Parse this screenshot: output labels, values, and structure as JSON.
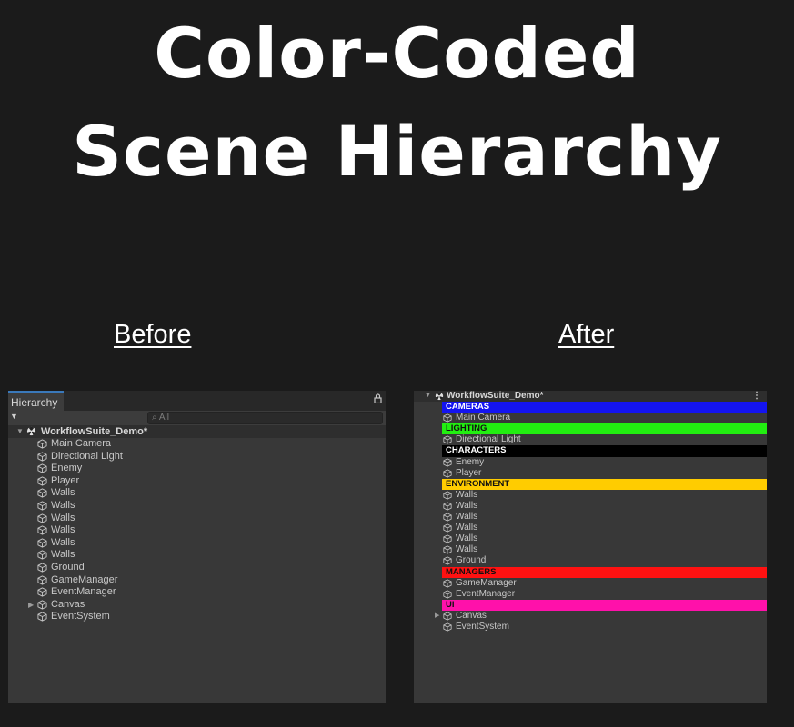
{
  "title": {
    "line1": "Color-Coded",
    "line2": "Scene Hierarchy"
  },
  "captions": {
    "before": "Before",
    "after": "After"
  },
  "before": {
    "tab_label": "Hierarchy",
    "lock_icon": "lock-icon",
    "search_placeholder": "All",
    "scene_name": "WorkflowSuite_Demo*",
    "items": [
      "Main Camera",
      "Directional Light",
      "Enemy",
      "Player",
      "Walls",
      "Walls",
      "Walls",
      "Walls",
      "Walls",
      "Walls",
      "Ground",
      "GameManager",
      "EventManager",
      "Canvas",
      "EventSystem"
    ]
  },
  "after": {
    "scene_name": "WorkflowSuite_Demo*",
    "rows": [
      {
        "kind": "header",
        "label": "CAMERAS",
        "bg": "#1414f0",
        "fg": "#ffffff"
      },
      {
        "kind": "item",
        "label": "Main Camera"
      },
      {
        "kind": "header",
        "label": "LIGHTING",
        "bg": "#22ee11",
        "fg": "#111111"
      },
      {
        "kind": "item",
        "label": "Directional Light"
      },
      {
        "kind": "header",
        "label": "CHARACTERS",
        "bg": "#000000",
        "fg": "#ffffff"
      },
      {
        "kind": "item",
        "label": "Enemy"
      },
      {
        "kind": "item",
        "label": "Player"
      },
      {
        "kind": "header",
        "label": "ENVIRONMENT",
        "bg": "#ffcc00",
        "fg": "#111111"
      },
      {
        "kind": "item",
        "label": "Walls"
      },
      {
        "kind": "item",
        "label": "Walls"
      },
      {
        "kind": "item",
        "label": "Walls"
      },
      {
        "kind": "item",
        "label": "Walls"
      },
      {
        "kind": "item",
        "label": "Walls"
      },
      {
        "kind": "item",
        "label": "Walls"
      },
      {
        "kind": "item",
        "label": "Ground"
      },
      {
        "kind": "header",
        "label": "MANAGERS",
        "bg": "#ff1111",
        "fg": "#111111"
      },
      {
        "kind": "item",
        "label": "GameManager"
      },
      {
        "kind": "item",
        "label": "EventManager"
      },
      {
        "kind": "header",
        "label": "UI",
        "bg": "#ff11aa",
        "fg": "#111111"
      },
      {
        "kind": "item",
        "label": "Canvas",
        "expandable": true
      },
      {
        "kind": "item",
        "label": "EventSystem"
      }
    ]
  }
}
